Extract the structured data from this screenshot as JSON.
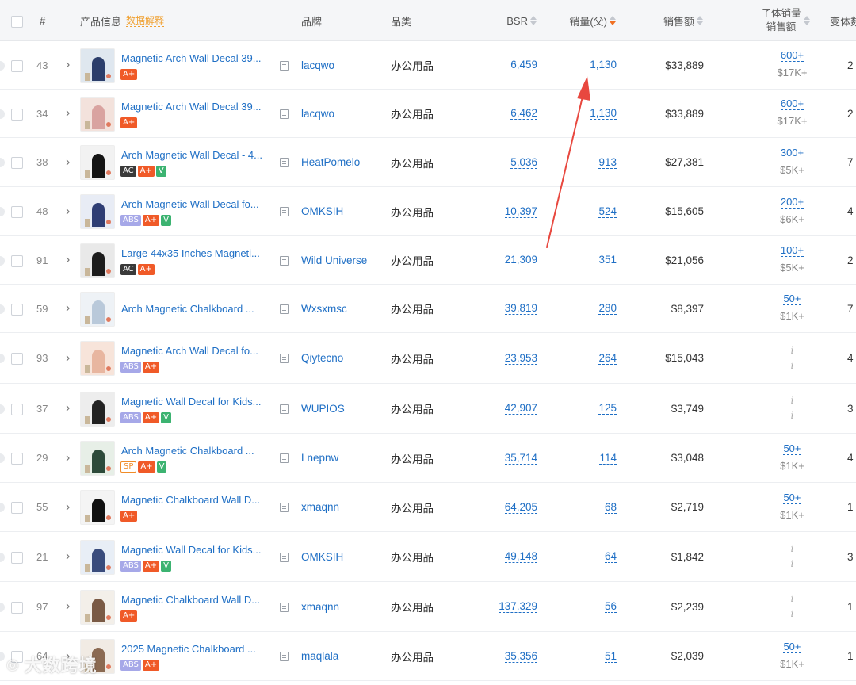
{
  "header": {
    "rank": "#",
    "product_info": "产品信息",
    "data_explain": "数据解释",
    "brand": "品牌",
    "category": "品类",
    "bsr": "BSR",
    "sales_volume": "销量(父)",
    "revenue": "销售额",
    "child_sales_line1": "子体销量",
    "child_sales_line2": "销售额",
    "variants": "变体数"
  },
  "colors": {
    "link": "#1f6fc5",
    "accent_orange": "#f07023",
    "header_bg": "#f5f6f8",
    "arrow": "#e8483f"
  },
  "rows": [
    {
      "rank": "43",
      "title": "Magnetic Arch Wall Decal 39...",
      "badges": [
        "A+"
      ],
      "brand": "lacqwo",
      "category": "办公用品",
      "bsr": "6,459",
      "volume": "1,130",
      "revenue": "$33,889",
      "child_top": "600+",
      "child_bottom": "$17K+",
      "variants": "2",
      "thumb": "arch-blue"
    },
    {
      "rank": "34",
      "title": "Magnetic Arch Wall Decal 39...",
      "badges": [
        "A+"
      ],
      "brand": "lacqwo",
      "category": "办公用品",
      "bsr": "6,462",
      "volume": "1,130",
      "revenue": "$33,889",
      "child_top": "600+",
      "child_bottom": "$17K+",
      "variants": "2",
      "thumb": "arch-pink"
    },
    {
      "rank": "38",
      "title": "Arch Magnetic Wall Decal - 4...",
      "badges": [
        "AC",
        "A+",
        "V"
      ],
      "brand": "HeatPomelo",
      "category": "办公用品",
      "bsr": "5,036",
      "volume": "913",
      "revenue": "$27,381",
      "child_top": "300+",
      "child_bottom": "$5K+",
      "variants": "7",
      "thumb": "arch-black"
    },
    {
      "rank": "48",
      "title": "Arch Magnetic Wall Decal fo...",
      "badges": [
        "ABS",
        "A+",
        "V"
      ],
      "brand": "OMKSIH",
      "category": "办公用品",
      "bsr": "10,397",
      "volume": "524",
      "revenue": "$15,605",
      "child_top": "200+",
      "child_bottom": "$6K+",
      "variants": "4",
      "thumb": "arch-navy"
    },
    {
      "rank": "91",
      "title": "Large 44x35 Inches Magneti...",
      "badges": [
        "AC",
        "A+"
      ],
      "brand": "Wild Universe",
      "category": "办公用品",
      "bsr": "21,309",
      "volume": "351",
      "revenue": "$21,056",
      "child_top": "100+",
      "child_bottom": "$5K+",
      "variants": "2",
      "thumb": "board-black"
    },
    {
      "rank": "59",
      "title": "Arch Magnetic Chalkboard ...",
      "badges": [],
      "brand": "Wxsxmsc",
      "category": "办公用品",
      "bsr": "39,819",
      "volume": "280",
      "revenue": "$8,397",
      "child_top": "50+",
      "child_bottom": "$1K+",
      "variants": "7",
      "thumb": "arch-light"
    },
    {
      "rank": "93",
      "title": "Magnetic Arch Wall Decal fo...",
      "badges": [
        "ABS",
        "A+"
      ],
      "brand": "Qiytecno",
      "category": "办公用品",
      "bsr": "23,953",
      "volume": "264",
      "revenue": "$15,043",
      "child_top": "",
      "child_bottom": "",
      "variants": "4",
      "thumb": "arch-peach"
    },
    {
      "rank": "37",
      "title": "Magnetic Wall Decal for Kids...",
      "badges": [
        "ABS",
        "A+",
        "V"
      ],
      "brand": "WUPIOS",
      "category": "办公用品",
      "bsr": "42,907",
      "volume": "125",
      "revenue": "$3,749",
      "child_top": "",
      "child_bottom": "",
      "variants": "3",
      "thumb": "arch-black2"
    },
    {
      "rank": "29",
      "title": "Arch Magnetic Chalkboard ...",
      "badges": [
        "SP",
        "A+",
        "V"
      ],
      "brand": "Lnepnw",
      "category": "办公用品",
      "bsr": "35,714",
      "volume": "114",
      "revenue": "$3,048",
      "child_top": "50+",
      "child_bottom": "$1K+",
      "variants": "4",
      "thumb": "arch-green"
    },
    {
      "rank": "55",
      "title": "Magnetic Chalkboard Wall D...",
      "badges": [
        "A+"
      ],
      "brand": "xmaqnn",
      "category": "办公用品",
      "bsr": "64,205",
      "volume": "68",
      "revenue": "$2,719",
      "child_top": "50+",
      "child_bottom": "$1K+",
      "variants": "1",
      "thumb": "arch-black3"
    },
    {
      "rank": "21",
      "title": "Magnetic Wall Decal for Kids...",
      "badges": [
        "ABS",
        "A+",
        "V"
      ],
      "brand": "OMKSIH",
      "category": "办公用品",
      "bsr": "49,148",
      "volume": "64",
      "revenue": "$1,842",
      "child_top": "",
      "child_bottom": "",
      "variants": "3",
      "thumb": "arch-navy2"
    },
    {
      "rank": "97",
      "title": "Magnetic Chalkboard Wall D...",
      "badges": [
        "A+"
      ],
      "brand": "xmaqnn",
      "category": "办公用品",
      "bsr": "137,329",
      "volume": "56",
      "revenue": "$2,239",
      "child_top": "",
      "child_bottom": "",
      "variants": "1",
      "thumb": "arch-brown"
    },
    {
      "rank": "64",
      "title": "2025 Magnetic Chalkboard ...",
      "badges": [
        "ABS",
        "A+"
      ],
      "brand": "maqlala",
      "category": "办公用品",
      "bsr": "35,356",
      "volume": "51",
      "revenue": "$2,039",
      "child_top": "50+",
      "child_bottom": "$1K+",
      "variants": "1",
      "thumb": "arch-brown2"
    }
  ],
  "watermark": "大数跨境"
}
